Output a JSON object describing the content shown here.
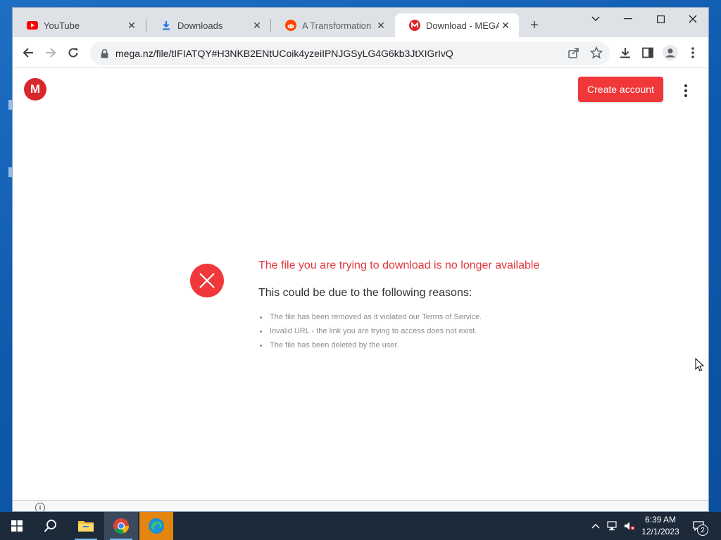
{
  "browser": {
    "tabs": [
      {
        "title": "YouTube",
        "icon": "youtube-icon",
        "active": false
      },
      {
        "title": "Downloads",
        "icon": "download-icon",
        "active": false
      },
      {
        "title": "A Transformation Pa",
        "icon": "reddit-icon",
        "active": false
      },
      {
        "title": "Download - MEGA",
        "icon": "mega-icon",
        "active": true
      }
    ],
    "url": "mega.nz/file/tIFIATQY#H3NKB2ENtUCoik4yzeiIPNJGSyLG4G6kb3JtXIGrIvQ"
  },
  "page": {
    "logo_letter": "M",
    "create_account_label": "Create account",
    "error_title": "The file you are trying to download is no longer available",
    "error_subtitle": "This could be due to the following reasons:",
    "reasons": [
      "The file has been removed as it violated our Terms of Service.",
      "Invalid URL - the link you are trying to access does not exist.",
      "The file has been deleted by the user."
    ],
    "info_glyph": "i"
  },
  "taskbar": {
    "time": "6:39 AM",
    "date": "12/1/2023",
    "notification_count": "2"
  },
  "colors": {
    "mega_red": "#d9272e",
    "button_red": "#f0373a",
    "error_text": "#e0393e",
    "taskbar": "#1c2a3a",
    "desktop": "#0f5aad"
  }
}
